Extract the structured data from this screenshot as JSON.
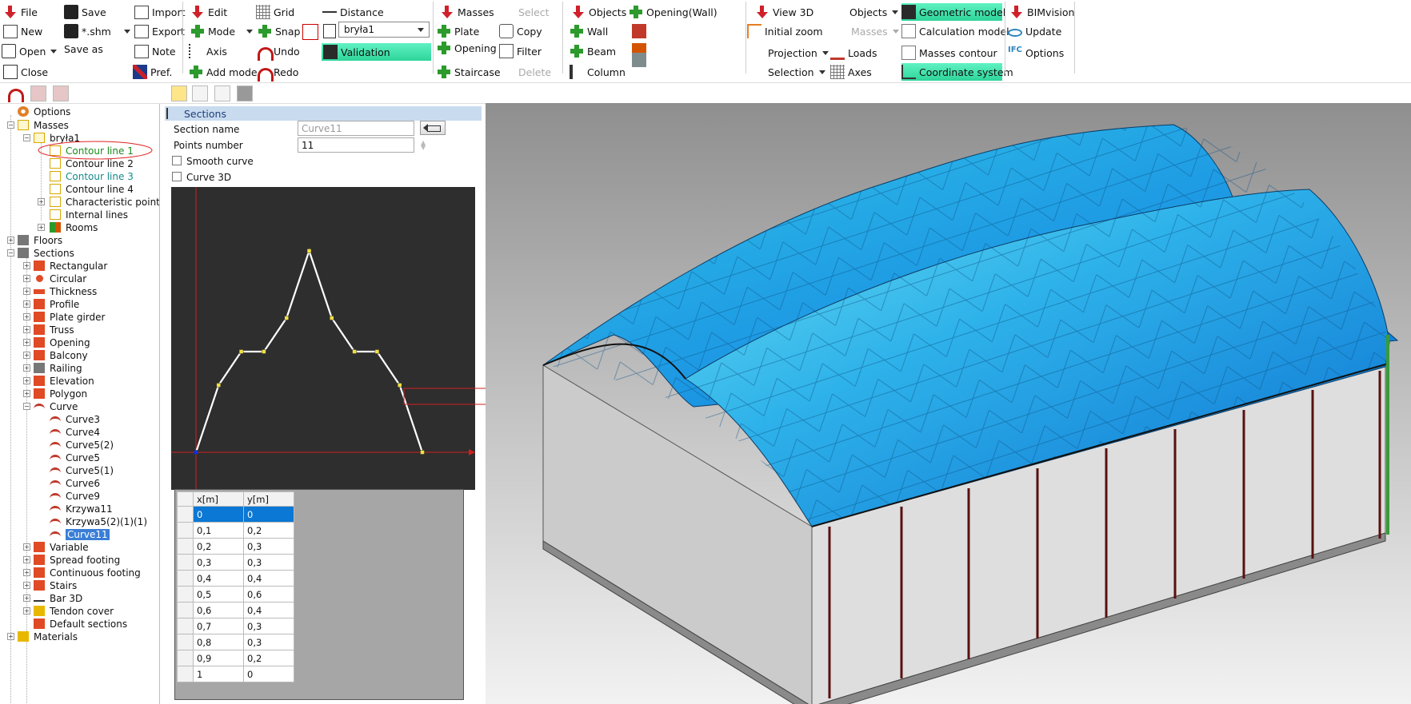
{
  "ribbon": {
    "file": "File",
    "new": "New",
    "open": "Open",
    "close": "Close",
    "save": "Save",
    "shm": "*.shm",
    "save_as": "Save as",
    "import": "Import",
    "export": "Export",
    "note": "Note",
    "pref": "Pref.",
    "edit": "Edit",
    "mode": "Mode",
    "axis": "Axis",
    "add_mode": "Add mode",
    "grid": "Grid",
    "snap": "Snap",
    "undo": "Undo",
    "redo": "Redo",
    "distance": "Distance",
    "solid_select": "bryła1",
    "validation": "Validation",
    "masses": "Masses",
    "select": "Select",
    "plate": "Plate",
    "copy": "Copy",
    "opening": "Opening",
    "filter": "Filter",
    "staircase": "Staircase",
    "delete": "Delete",
    "objects": "Objects",
    "opening_wall": "Opening(Wall)",
    "wall": "Wall",
    "beam": "Beam",
    "column": "Column",
    "view3d": "View 3D",
    "initial_zoom": "Initial zoom",
    "projection": "Projection",
    "selection": "Selection",
    "objects2": "Objects",
    "masses2": "Masses",
    "loads": "Loads",
    "axes": "Axes",
    "geometric_model": "Geometric model",
    "calculation_model": "Calculation model",
    "masses_contour": "Masses contour",
    "coordinate_system": "Coordinate system",
    "bimvision": "BIMvision",
    "update": "Update",
    "options": "Options"
  },
  "tree": {
    "options": "Options",
    "masses": "Masses",
    "solid": "bryła1",
    "contour1": "Contour line 1",
    "contour2": "Contour line 2",
    "contour3": "Contour line 3",
    "contour4": "Contour line 4",
    "char_points": "Characteristic points",
    "internal_lines": "Internal lines",
    "rooms": "Rooms",
    "floors": "Floors",
    "sections": "Sections",
    "rectangular": "Rectangular",
    "circular": "Circular",
    "thickness": "Thickness",
    "profile": "Profile",
    "plate_girder": "Plate girder",
    "truss": "Truss",
    "opening": "Opening",
    "balcony": "Balcony",
    "railing": "Railing",
    "elevation": "Elevation",
    "polygon": "Polygon",
    "curve": "Curve",
    "curves": [
      "Curve3",
      "Curve4",
      "Curve5(2)",
      "Curve5",
      "Curve5(1)",
      "Curve6",
      "Curve9",
      "Krzywa11",
      "Krzywa5(2)(1)(1)",
      "Curve11"
    ],
    "variable": "Variable",
    "spread_footing": "Spread footing",
    "continuous_footing": "Continuous footing",
    "stairs": "Stairs",
    "bar3d": "Bar 3D",
    "tendon_cover": "Tendon cover",
    "default_sections": "Default sections",
    "materials": "Materials"
  },
  "form": {
    "title": "Sections",
    "section_name_label": "Section name",
    "section_name_value": "Curve11",
    "points_label": "Points number",
    "points_value": "11",
    "smooth_curve": "Smooth curve",
    "curve3d": "Curve 3D"
  },
  "table": {
    "headers": [
      "x[m]",
      "y[m]"
    ],
    "rows": [
      [
        "0",
        "0"
      ],
      [
        "0,1",
        "0,2"
      ],
      [
        "0,2",
        "0,3"
      ],
      [
        "0,3",
        "0,3"
      ],
      [
        "0,4",
        "0,4"
      ],
      [
        "0,5",
        "0,6"
      ],
      [
        "0,6",
        "0,4"
      ],
      [
        "0,7",
        "0,3"
      ],
      [
        "0,8",
        "0,3"
      ],
      [
        "0,9",
        "0,2"
      ],
      [
        "1",
        "0"
      ]
    ]
  },
  "curve_points": [
    [
      0,
      0
    ],
    [
      0.1,
      0.2
    ],
    [
      0.2,
      0.3
    ],
    [
      0.3,
      0.3
    ],
    [
      0.4,
      0.4
    ],
    [
      0.5,
      0.6
    ],
    [
      0.6,
      0.4
    ],
    [
      0.7,
      0.3
    ],
    [
      0.8,
      0.3
    ],
    [
      0.9,
      0.2
    ],
    [
      1,
      0
    ]
  ],
  "colors": {
    "accent_green": "#3fe3b0",
    "selection_blue": "#0a78d4",
    "roof_blue": "#1e8fe0"
  }
}
